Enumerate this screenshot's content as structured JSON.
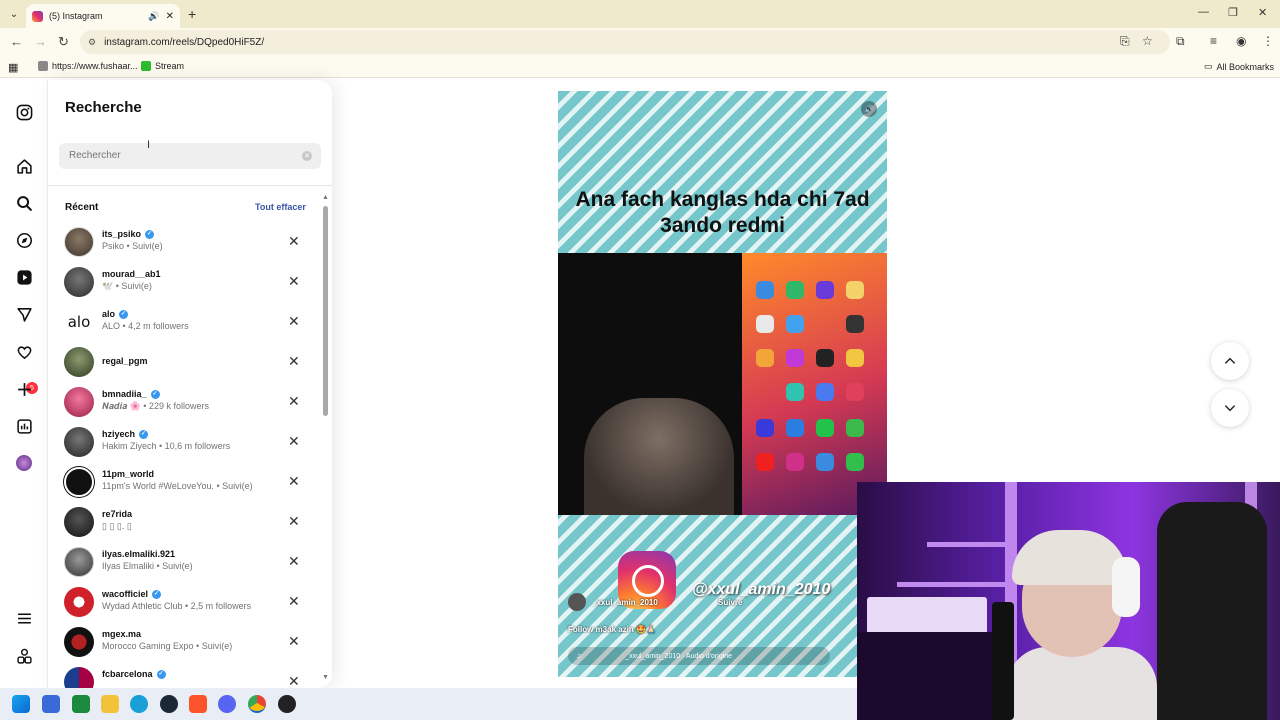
{
  "browser": {
    "tab_title": "(5) Instagram",
    "tab_close": "✕",
    "new_tab": "+",
    "url": "instagram.com/reels/DQped0HiF5Z/",
    "bookmarks": [
      {
        "label": "https://www.fushaar..."
      },
      {
        "label": "Stream"
      }
    ],
    "all_bookmarks": "All Bookmarks",
    "accent": "#efeacb"
  },
  "rail": {
    "notification_count": "5"
  },
  "search_panel": {
    "title": "Recherche",
    "placeholder": "Rechercher",
    "recent_label": "Récent",
    "clear_all": "Tout effacer",
    "remove_glyph": "✕",
    "items": [
      {
        "username": "its_psiko",
        "verified": true,
        "subtitle": "Psiko • Suivi(e)"
      },
      {
        "username": "mourad__ab1",
        "verified": false,
        "subtitle": "🕊️ • Suivi(e)"
      },
      {
        "username": "alo",
        "verified": true,
        "subtitle": "ALO • 4,2 m followers"
      },
      {
        "username": "regal_pgm",
        "verified": false,
        "subtitle": ""
      },
      {
        "username": "bmnadiia_",
        "verified": true,
        "subtitle": "𝑵𝒂𝒅𝒊𝒂 🌸 • 229 k followers"
      },
      {
        "username": "hziyech",
        "verified": true,
        "subtitle": "Hakim Ziyech • 10,6 m followers"
      },
      {
        "username": "11pm_world",
        "verified": false,
        "subtitle": "11pm's World #WeLoveYou. • Suivi(e)"
      },
      {
        "username": "re7rida",
        "verified": false,
        "subtitle": "▯ ▯ ▯. ▯"
      },
      {
        "username": "ilyas.elmaliki.921",
        "verified": false,
        "subtitle": "Ilyas Elmaliki • Suivi(e)"
      },
      {
        "username": "wacofficiel",
        "verified": true,
        "subtitle": "Wydad Athletic Club • 2,5 m followers"
      },
      {
        "username": "mgex.ma",
        "verified": false,
        "subtitle": "Morocco Gaming Expo • Suivi(e)"
      },
      {
        "username": "fcbarcelona",
        "verified": true,
        "subtitle": ""
      }
    ]
  },
  "reel": {
    "overlay_text": "Ana fach kanglas hda chi 7ad 3ando redmi",
    "watermark_handle": "@xxul_amin_2010",
    "author": "_xxul_amin_2010",
    "follow": "Suivre",
    "caption": "Follow m3ak azin 🤩🙏🏻",
    "audio": "_xxul_amin_2010 · Audio d'origine",
    "colors": {
      "stripe": "#76c7cc",
      "stripe_light": "#e4f3f3"
    }
  },
  "navigation": {
    "up": "⌃",
    "down": "⌄"
  }
}
